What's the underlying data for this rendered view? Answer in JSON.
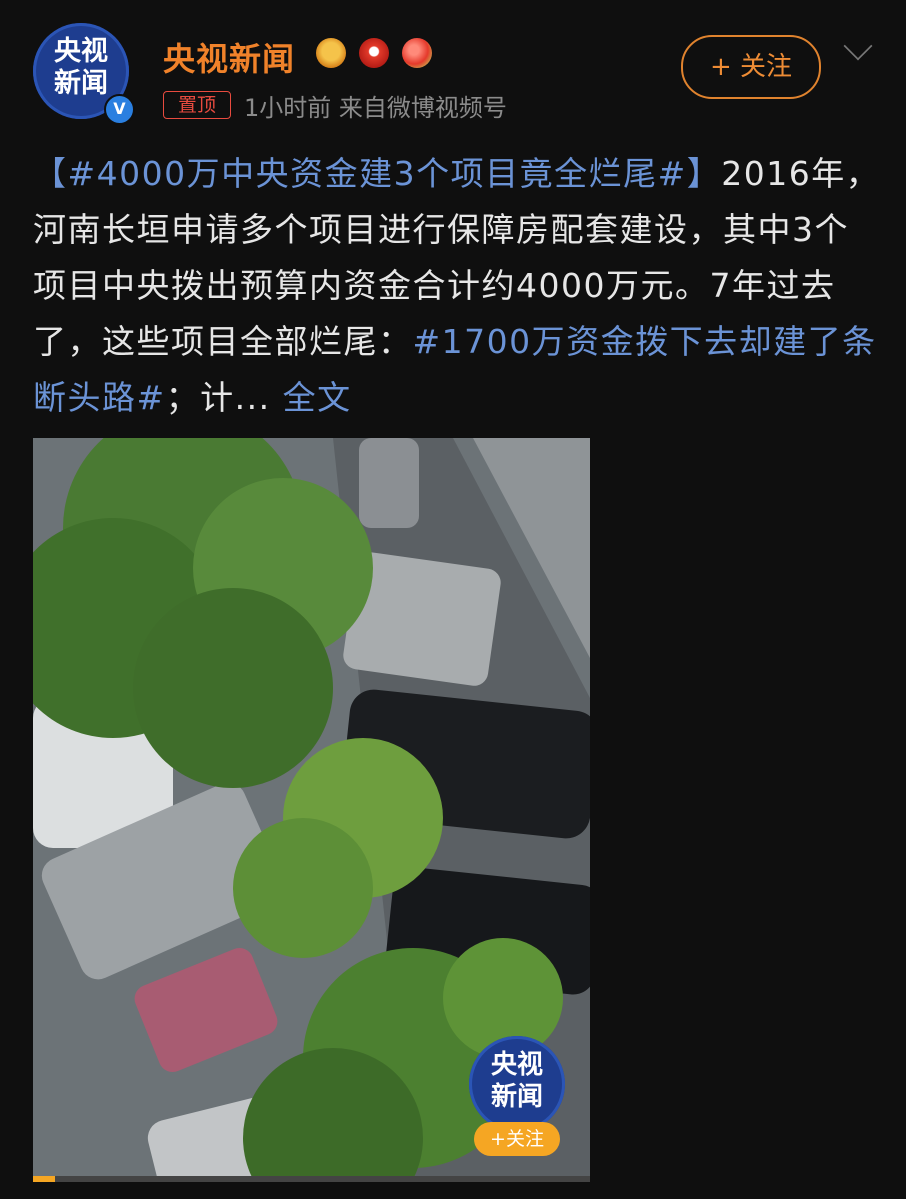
{
  "account": {
    "avatar_line1": "央视",
    "avatar_line2": "新闻",
    "name": "央视新闻",
    "pin_label": "置顶",
    "meta": "1小时前  来自微博视频号",
    "follow_label": "+ 关注"
  },
  "post": {
    "tag1": "【#4000万中央资金建3个项目竟全烂尾#】",
    "body": "2016年，河南长垣申请多个项目进行保障房配套建设，其中3个项目中央拨出预算内资金合计约4000万元。7年过去了，这些项目全部烂尾：",
    "tag2": "#1700万资金拨下去却建了条断头路#",
    "trail": "；计...",
    "more_label": "全文"
  },
  "video": {
    "watermark_line1": "央视",
    "watermark_line2": "新闻",
    "watermark_follow": "+关注",
    "progress_fraction": 0.04
  },
  "colors": {
    "brand_orange": "#f0822a",
    "link_blue": "#6b93d6",
    "pin_red": "#e84b3f"
  }
}
